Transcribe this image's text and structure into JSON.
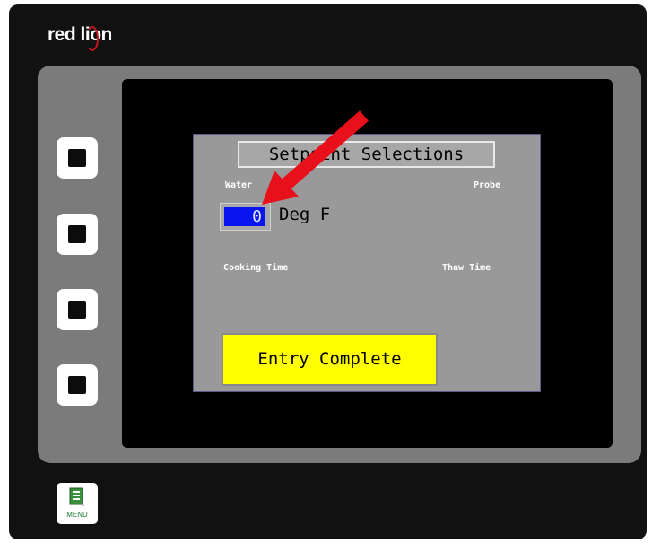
{
  "brand": {
    "name_part1": "red l",
    "name_part2": "on",
    "lion_char": "i"
  },
  "display": {
    "title": "Setpoint Selections",
    "labels": {
      "water": "Water",
      "probe": "Probe",
      "cooking": "Cooking Time",
      "thaw": "Thaw Time"
    },
    "temperature": {
      "value": "0",
      "unit": "Deg F"
    },
    "entry_button": "Entry Complete"
  },
  "menu_key": {
    "label": "MENU"
  },
  "colors": {
    "entry_button": "#ffff00",
    "value_field": "#0a14f0",
    "arrow": "#e8101a",
    "screen_bg": "#999999"
  },
  "icons": [
    "soft-key",
    "menu-icon",
    "red-arrow-annotation"
  ]
}
